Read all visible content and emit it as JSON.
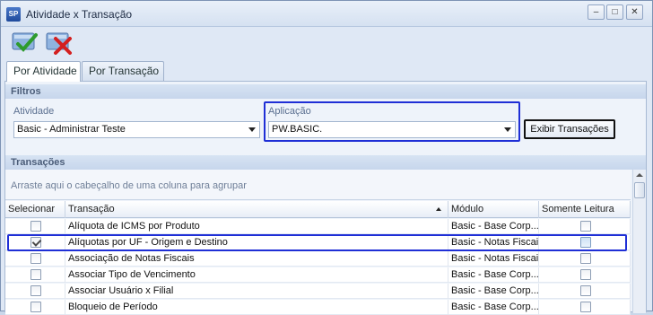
{
  "window": {
    "app_icon_label": "SP",
    "title": "Atividade x Transação",
    "minimize": "–",
    "maximize": "□",
    "close": "✕"
  },
  "toolbar": {
    "confirm_icon": "check-icon",
    "cancel_icon": "cancel-x-icon"
  },
  "tabs": [
    {
      "label": "Por Atividade",
      "active": true
    },
    {
      "label": "Por Transação",
      "active": false
    }
  ],
  "filters": {
    "section_title": "Filtros",
    "atividade_label": "Atividade",
    "atividade_value": "Basic - Administrar Teste",
    "aplicacao_label": "Aplicação",
    "aplicacao_value": "PW.BASIC.",
    "exibir_button": "Exibir Transações"
  },
  "transacoes": {
    "section_title": "Transações",
    "group_hint": "Arraste aqui o cabeçalho de uma coluna para agrupar",
    "columns": {
      "selecionar": "Selecionar",
      "transacao": "Transação",
      "modulo": "Módulo",
      "somente_leitura": "Somente Leitura"
    },
    "rows": [
      {
        "selected": false,
        "transacao": "Alíquota de ICMS por Produto",
        "modulo": "Basic - Base Corp...",
        "somente_leitura": false
      },
      {
        "selected": true,
        "transacao": "Alíquotas por UF - Origem e Destino",
        "modulo": "Basic - Notas Fiscais",
        "somente_leitura": false
      },
      {
        "selected": false,
        "transacao": "Associação de Notas Fiscais",
        "modulo": "Basic - Notas Fiscais",
        "somente_leitura": false
      },
      {
        "selected": false,
        "transacao": "Associar Tipo de Vencimento",
        "modulo": "Basic - Base Corp...",
        "somente_leitura": false
      },
      {
        "selected": false,
        "transacao": "Associar Usuário x Filial",
        "modulo": "Basic - Base Corp...",
        "somente_leitura": false
      },
      {
        "selected": false,
        "transacao": "Bloqueio de Período",
        "modulo": "Basic - Base Corp...",
        "somente_leitura": false
      }
    ]
  },
  "colors": {
    "highlight_border": "#1f2fd6",
    "check_green": "#2e9b2e",
    "cancel_red": "#d42020"
  }
}
